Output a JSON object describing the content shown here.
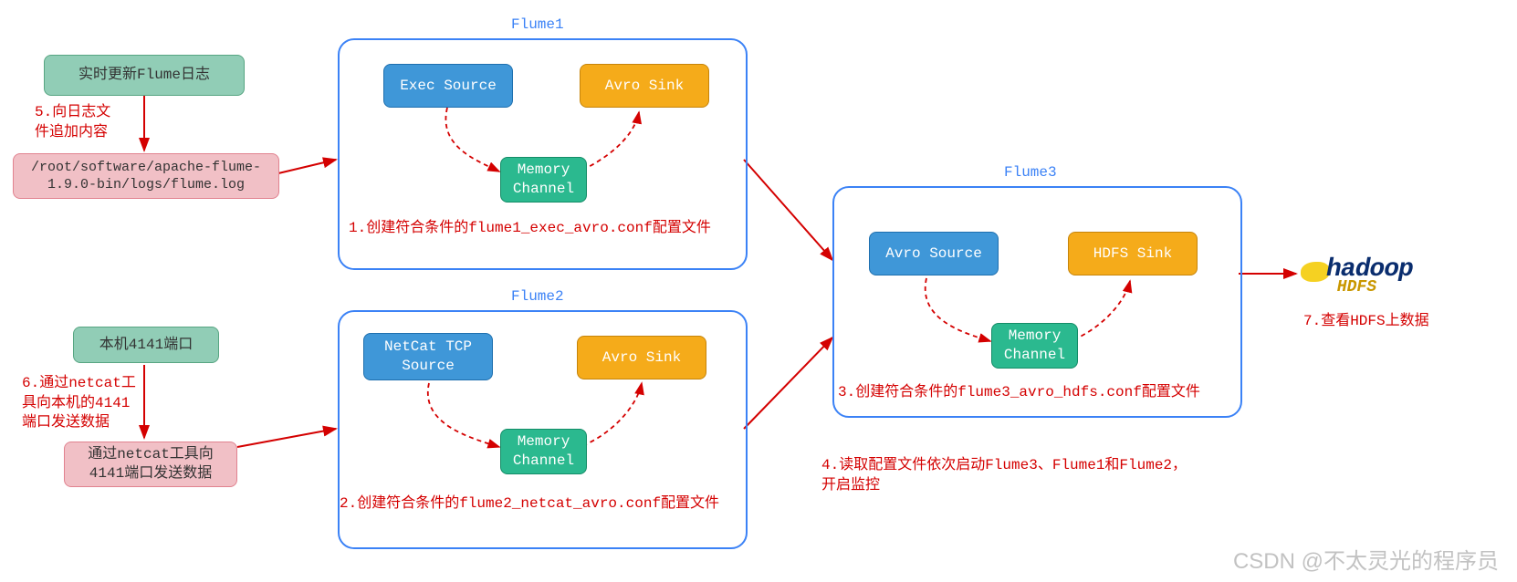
{
  "left": {
    "logbox": "实时更新Flume日志",
    "filepath": "/root/software/apache-flume-1.9.0-bin/logs/flume.log",
    "portbox": "本机4141端口",
    "netcatbox": "通过netcat工具向\n4141端口发送数据"
  },
  "flume1": {
    "title": "Flume1",
    "source": "Exec Source",
    "sink": "Avro Sink",
    "channel": "Memory\nChannel",
    "note": "1.创建符合条件的flume1_exec_avro.conf配置文件"
  },
  "flume2": {
    "title": "Flume2",
    "source": "NetCat TCP\nSource",
    "sink": "Avro Sink",
    "channel": "Memory\nChannel",
    "note": "2.创建符合条件的flume2_netcat_avro.conf配置文件"
  },
  "flume3": {
    "title": "Flume3",
    "source": "Avro Source",
    "sink": "HDFS Sink",
    "channel": "Memory\nChannel",
    "note": "3.创建符合条件的flume3_avro_hdfs.conf配置文件"
  },
  "steps": {
    "s4": "4.读取配置文件依次启动Flume3、Flume1和Flume2，\n开启监控",
    "s5": "5.向日志文\n件追加内容",
    "s6": "6.通过netcat工\n具向本机的4141\n端口发送数据",
    "s7": "7.查看HDFS上数据"
  },
  "hadoop": {
    "name": "hadoop",
    "sub": "HDFS"
  },
  "watermark": "CSDN @不太灵光的程序员"
}
